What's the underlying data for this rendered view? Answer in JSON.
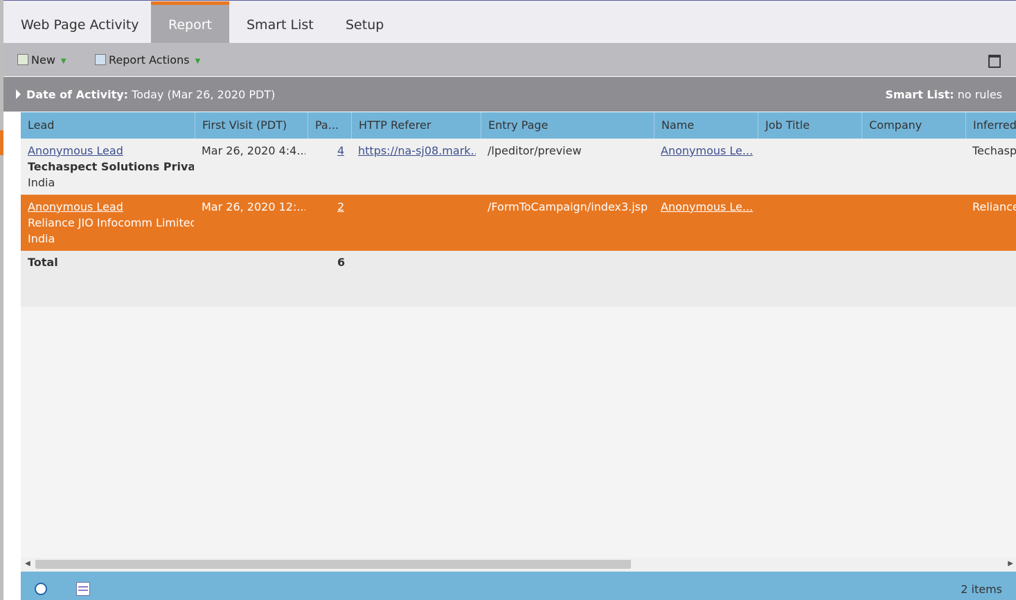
{
  "tabs": [
    {
      "label": "Web Page Activity"
    },
    {
      "label": "Report"
    },
    {
      "label": "Smart List"
    },
    {
      "label": "Setup"
    }
  ],
  "toolbar": {
    "new_label": "New",
    "report_actions_label": "Report Actions"
  },
  "filter": {
    "date_label": "Date of Activity:",
    "date_value": "Today (Mar 26, 2020 PDT)",
    "smartlist_label": "Smart List:",
    "smartlist_value": "no rules"
  },
  "columns": [
    "Lead",
    "First Visit (PDT)",
    "Pa...",
    "HTTP Referer",
    "Entry Page",
    "Name",
    "Job Title",
    "Company",
    "Inferred"
  ],
  "rows": [
    {
      "lead_link": "Anonymous Lead",
      "lead_company": "Techaspect Solutions Private l",
      "lead_country": "India",
      "first_visit": "Mar 26, 2020 4:4...",
      "pages": "4",
      "referer": "https://na-sj08.mark...",
      "entry_page": "/lpeditor/preview",
      "name": "Anonymous Le...",
      "job_title": "",
      "company": "",
      "inferred": "Techasp"
    },
    {
      "lead_link": "Anonymous Lead",
      "lead_company": "Reliance JIO Infocomm Limited",
      "lead_country": "India",
      "first_visit": "Mar 26, 2020 12:...",
      "pages": "2",
      "referer": "",
      "entry_page": "/FormToCampaign/index3.jsp",
      "name": "Anonymous Le...",
      "job_title": "",
      "company": "",
      "inferred": "Reliance"
    }
  ],
  "total": {
    "label": "Total",
    "pages": "6"
  },
  "footer": {
    "count": "2 items"
  },
  "colors": {
    "accent": "#e87722",
    "header": "#73b5d9",
    "link": "#3d4f8f"
  }
}
